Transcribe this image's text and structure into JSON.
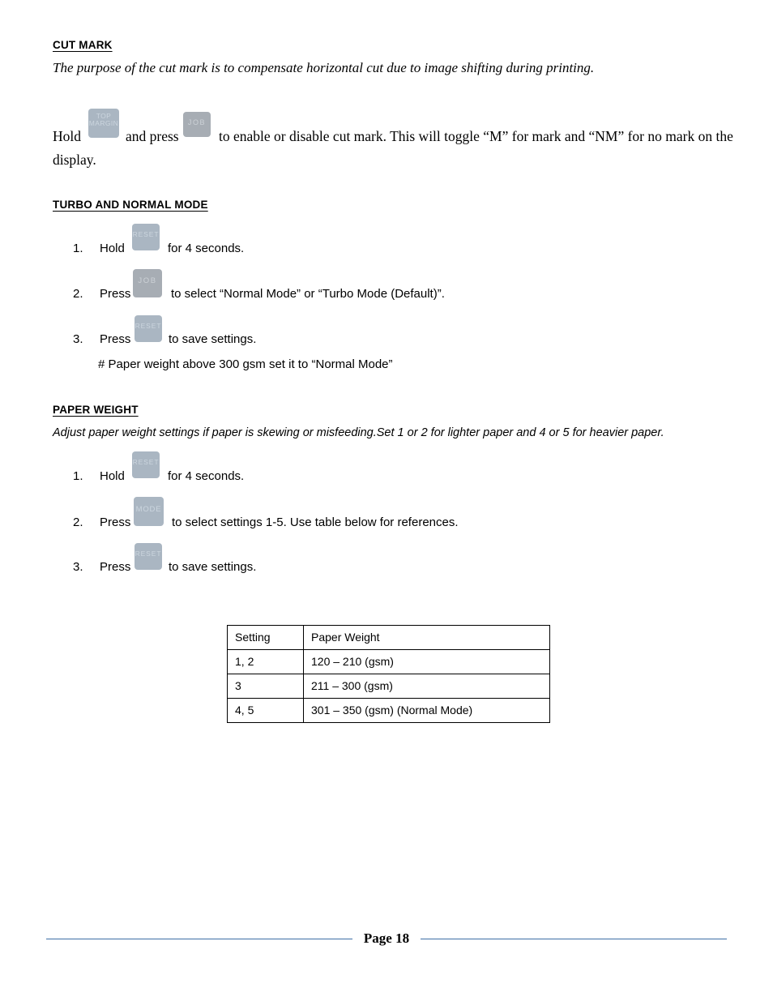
{
  "document": {
    "page_label": "Page 18"
  },
  "sections": {
    "cut_mark": {
      "heading": "CUT MARK",
      "description": "The purpose of the cut mark is to compensate horizontal cut due to image shifting during printing.",
      "line1_a": "Hold",
      "line1_b": "and press",
      "line1_c": "to enable or disable cut mark.    This will toggle “M” for mark and “NM” for no mark on the",
      "line2": "display.",
      "keys": {
        "top_margin_line1": "TOP",
        "top_margin_line2": "MARGIN",
        "job": "JOB"
      }
    },
    "turbo_normal": {
      "heading": "TURBO AND NORMAL MODE",
      "steps": [
        {
          "number": "1.",
          "verb": "Hold",
          "key": "RESET",
          "text": "for 4 seconds."
        },
        {
          "number": "2.",
          "verb": "Press",
          "key": "JOB",
          "text": "to select “Normal Mode” or “Turbo Mode (Default)”."
        },
        {
          "number": "3.",
          "verb": "Press",
          "key": "RESET",
          "text": "to save settings."
        }
      ],
      "note": "# Paper weight above 300 gsm set it to “Normal Mode”"
    },
    "paper_weight": {
      "heading": "PAPER WEIGHT",
      "description": "Adjust paper weight settings if paper is skewing or misfeeding.Set 1 or 2 for lighter paper and 4 or 5 for heavier paper.",
      "steps": [
        {
          "number": "1.",
          "verb": "Hold",
          "key": "RESET",
          "text": "for 4 seconds."
        },
        {
          "number": "2.",
          "verb": "Press",
          "key": "MODE",
          "text": "to select settings 1-5.    Use table below for references."
        },
        {
          "number": "3.",
          "verb": "Press",
          "key": "RESET",
          "text": "to save settings."
        }
      ],
      "table": {
        "headers": [
          "Setting",
          "Paper Weight"
        ],
        "rows": [
          [
            "1, 2",
            "120 – 210 (gsm)"
          ],
          [
            "3",
            "211 – 300 (gsm)"
          ],
          [
            "4, 5",
            "301 – 350 (gsm) (Normal Mode)"
          ]
        ]
      }
    }
  },
  "colors": {
    "key_blue": "#aab6c2",
    "key_grey": "#a7adb4",
    "footer_rule": "#3c6ea5"
  }
}
